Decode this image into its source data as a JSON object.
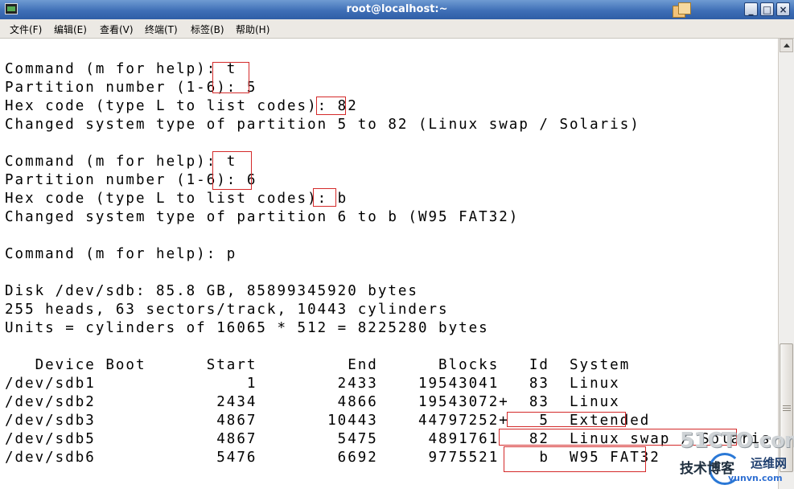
{
  "window": {
    "title": "root@localhost:~",
    "buttons": {
      "minimize": "_",
      "maximize": "□",
      "close": "×"
    }
  },
  "menu": [
    {
      "label": "文件(F)"
    },
    {
      "label": "编辑(E)"
    },
    {
      "label": "查看(V)"
    },
    {
      "label": "终端(T)"
    },
    {
      "label": "标签(B)"
    },
    {
      "label": "帮助(H)"
    }
  ],
  "terminal": {
    "lines": [
      "",
      "Command (m for help): t",
      "Partition number (1-6): 5",
      "Hex code (type L to list codes): 82",
      "Changed system type of partition 5 to 82 (Linux swap / Solaris)",
      "",
      "Command (m for help): t",
      "Partition number (1-6): 6",
      "Hex code (type L to list codes): b",
      "Changed system type of partition 6 to b (W95 FAT32)",
      "",
      "Command (m for help): p",
      "",
      "Disk /dev/sdb: 85.8 GB, 85899345920 bytes",
      "255 heads, 63 sectors/track, 10443 cylinders",
      "Units = cylinders of 16065 * 512 = 8225280 bytes",
      "",
      "   Device Boot      Start         End      Blocks   Id  System",
      "/dev/sdb1               1        2433    19543041   83  Linux",
      "/dev/sdb2            2434        4866    19543072+  83  Linux",
      "/dev/sdb3            4867       10443    44797252+   5  Extended",
      "/dev/sdb5            4867        5475     4891761   82  Linux swap / Solaris",
      "/dev/sdb6            5476        6692     9775521    b  W95 FAT32"
    ]
  },
  "watermark": {
    "brand": "51CTO.com",
    "subtitle": "技术博客",
    "yun": "运维网",
    "url": "yunvn.com"
  },
  "colors": {
    "highlight_box": "#d42a2a",
    "titlebar": "#3f6fb7"
  },
  "icons": {
    "app": "terminal-icon",
    "deco": "window-list-icon",
    "scroll": "scroll-up-arrow-icon"
  }
}
